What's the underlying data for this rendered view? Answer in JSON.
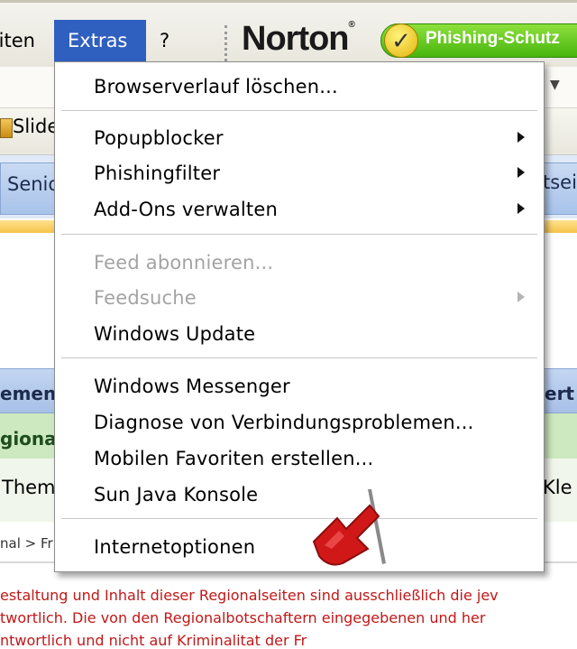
{
  "menubar": {
    "favoriten_partial": "riten",
    "extras": "Extras",
    "help": "?",
    "norton_logo": "Norton",
    "norton_reg": "®",
    "phishing_badge": "Phishing-Schutz"
  },
  "toolbar": {
    "slide_partial": "Slide"
  },
  "tabs": {
    "senioren_partial": "Senio",
    "startseite_partial": "tseit"
  },
  "page": {
    "bluebar_left": "emen",
    "bluebar_right": "ert",
    "greenbar_left": "giona",
    "row_left": "Them",
    "row_right": "Kle",
    "breadcrumb": "nal > Fr",
    "red_line_1": "estaltung und Inhalt dieser Regionalseiten sind ausschließlich die jev",
    "red_line_2": "twortlich. Die von den Regionalbotschaftern eingegebenen und her",
    "red_line_3": "ntwortlich und nicht auf Kriminalitat der Fr"
  },
  "dropdown": {
    "items": [
      {
        "label": "Browserverlauf löschen...",
        "disabled": false,
        "submenu": false
      },
      {
        "label": "Popupblocker",
        "disabled": false,
        "submenu": true
      },
      {
        "label": "Phishingfilter",
        "disabled": false,
        "submenu": true
      },
      {
        "label": "Add-Ons verwalten",
        "disabled": false,
        "submenu": true
      },
      {
        "label": "Feed abonnieren...",
        "disabled": true,
        "submenu": false
      },
      {
        "label": "Feedsuche",
        "disabled": true,
        "submenu": true
      },
      {
        "label": "Windows Update",
        "disabled": false,
        "submenu": false
      },
      {
        "label": "Windows Messenger",
        "disabled": false,
        "submenu": false
      },
      {
        "label": "Diagnose von Verbindungsproblemen...",
        "disabled": false,
        "submenu": false
      },
      {
        "label": "Mobilen Favoriten erstellen...",
        "disabled": false,
        "submenu": false
      },
      {
        "label": "Sun Java Konsole",
        "disabled": false,
        "submenu": false
      },
      {
        "label": "Internetoptionen",
        "disabled": false,
        "submenu": false
      }
    ]
  },
  "colors": {
    "menu_highlight": "#2f5fbf",
    "disabled_text": "#a3a3a3",
    "phishing_green": "#47b50e",
    "arrow_red": "#d11818",
    "warning_text": "#c01818"
  },
  "icons": {
    "slide_icon": "folder-icon",
    "check_icon": "checkmark-icon",
    "pointer": "red-arrow-icon"
  }
}
